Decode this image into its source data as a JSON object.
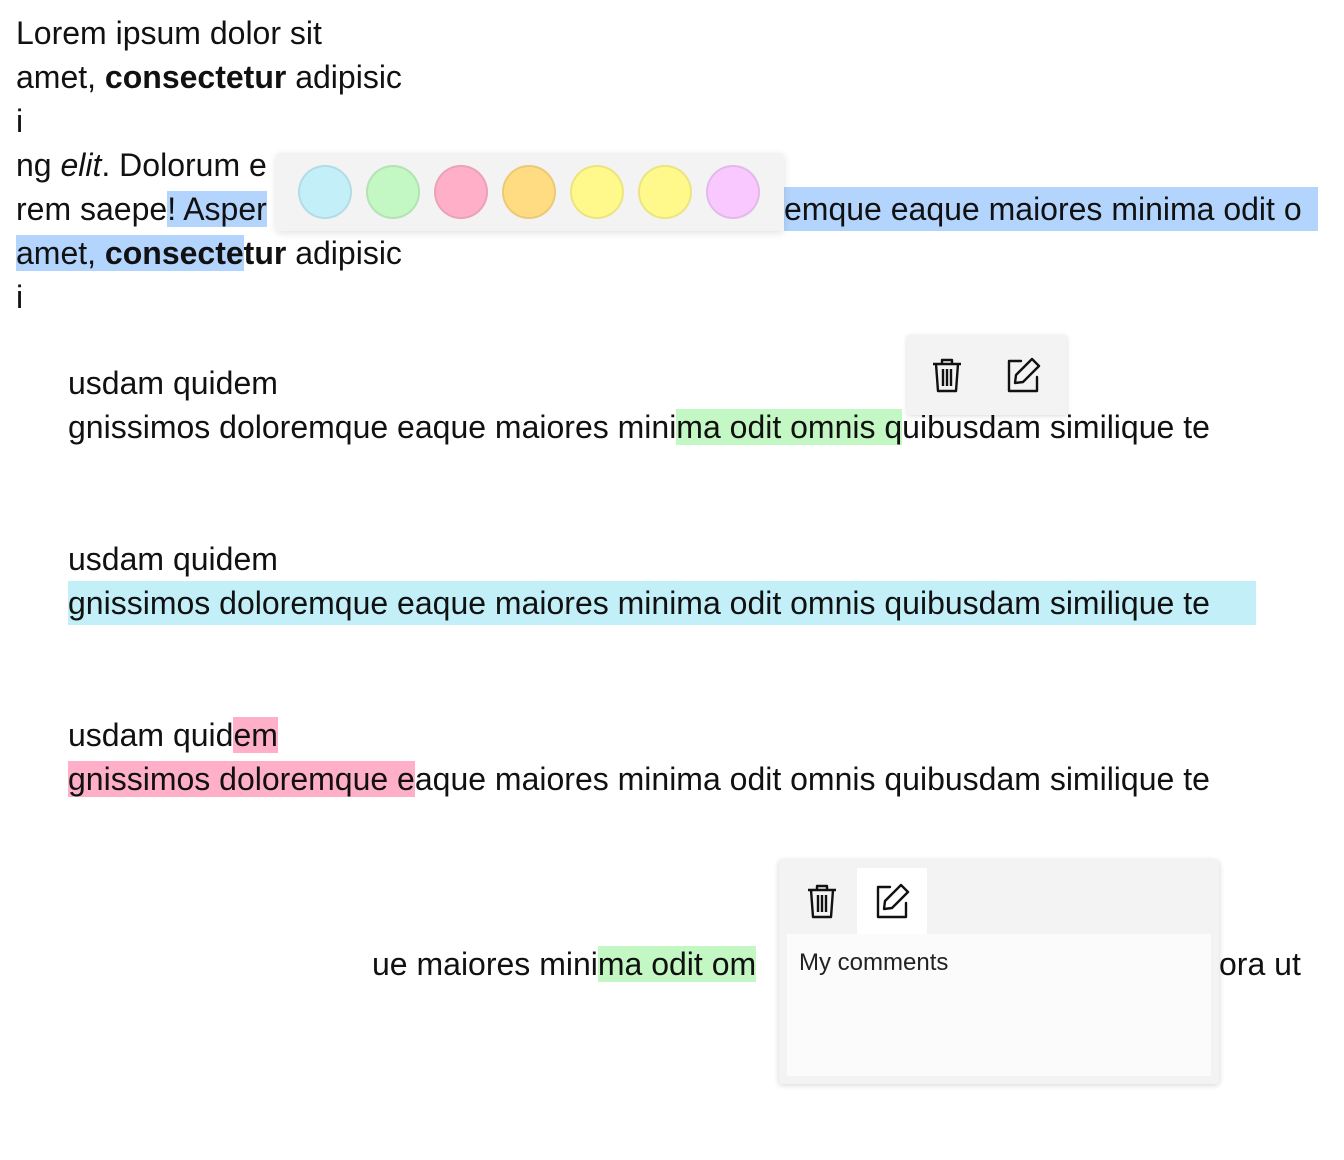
{
  "paragraph1": {
    "line1": "Lorem ipsum dolor sit",
    "line2_pre": "amet, ",
    "line2_bold": "consectetur",
    "line2_post": " adipisic",
    "line3": "i",
    "line4_pre": "ng ",
    "line4_italic": "elit",
    "line4_post": ". Dolorum e",
    "line5_pre": "rem saepe",
    "line5_sel": "! Asper",
    "line5_sel_tail": "emque eaque maiores minima odit o",
    "line6_sel_pre": "amet, ",
    "line6_sel_bold": "consecte",
    "line6_bold_rest": "tur",
    "line6_post": " adipisic",
    "line7": "i"
  },
  "block1": {
    "line1": "usdam quidem",
    "line2_pre": "gnissimos doloremque eaque maiores mini",
    "line2_hl": "ma odit omnis q",
    "line2_post": "uibusdam similique te"
  },
  "block2": {
    "line1": "usdam quidem",
    "line2_hl": "gnissimos doloremque eaque maiores minima odit omnis quibusdam similique te"
  },
  "block3": {
    "line1_pre": "usdam quid",
    "line1_hl": "em",
    "line2_hl": "gnissimos doloremque e",
    "line2_post": "aque maiores minima odit omnis quibusdam similique te"
  },
  "block4": {
    "line_pre": "ue maiores mini",
    "line_hl": "ma odit om",
    "line_tail": "ora ut"
  },
  "palette": {
    "colors": [
      "#c3eff8",
      "#c3f7c3",
      "#ffb0c8",
      "#ffdc82",
      "#fff98c",
      "#fff98c",
      "#f9c8ff"
    ]
  },
  "toolbar": {
    "delete_icon": "trash-icon",
    "edit_icon": "edit-icon"
  },
  "comment_popup": {
    "placeholder": "My comments"
  }
}
